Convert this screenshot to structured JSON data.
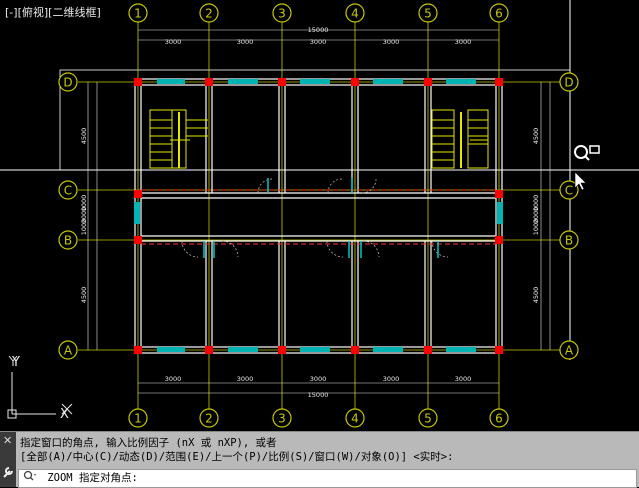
{
  "viewport": {
    "label_open": "[-]",
    "label_view": "[俯视]",
    "label_style": "[二维线框]"
  },
  "drawing": {
    "axes_numbers": [
      "1",
      "2",
      "3",
      "4",
      "5",
      "6"
    ],
    "axes_letters": [
      "D",
      "C",
      "B",
      "A"
    ],
    "top_span_dims": [
      "3000",
      "3000",
      "3000",
      "3000",
      "3000"
    ],
    "top_total_dim": "15000",
    "bottom_span_dims": [
      "3000",
      "3000",
      "3000",
      "3000",
      "3000"
    ],
    "bottom_total_dim": "15000",
    "left_dims": [
      "4500",
      "1000",
      "2000",
      "1000",
      "4500"
    ],
    "right_dims": [
      "4500",
      "1000",
      "2000",
      "1000",
      "4500"
    ],
    "ucs_x": "X",
    "ucs_y": "Y"
  },
  "command": {
    "history_line1": "指定窗口的角点, 输入比例因子 (nX 或 nXP), 或者",
    "history_line2": "[全部(A)/中心(C)/动态(D)/范围(E)/上一个(P)/比例(S)/窗口(W)/对象(O)] <实时>:",
    "input_prefix": "ZOOM",
    "input_text": "指定对角点:",
    "close_glyph": "✕",
    "wrench_glyph": "🔧"
  },
  "colors": {
    "background": "#000000",
    "axis_line": "#c8c800",
    "wall": "#ffffff",
    "wall_red": "#ff0000",
    "window": "#00c8c8",
    "dim_text": "#e8e8e8",
    "axis_bubble": "#c8c800"
  }
}
